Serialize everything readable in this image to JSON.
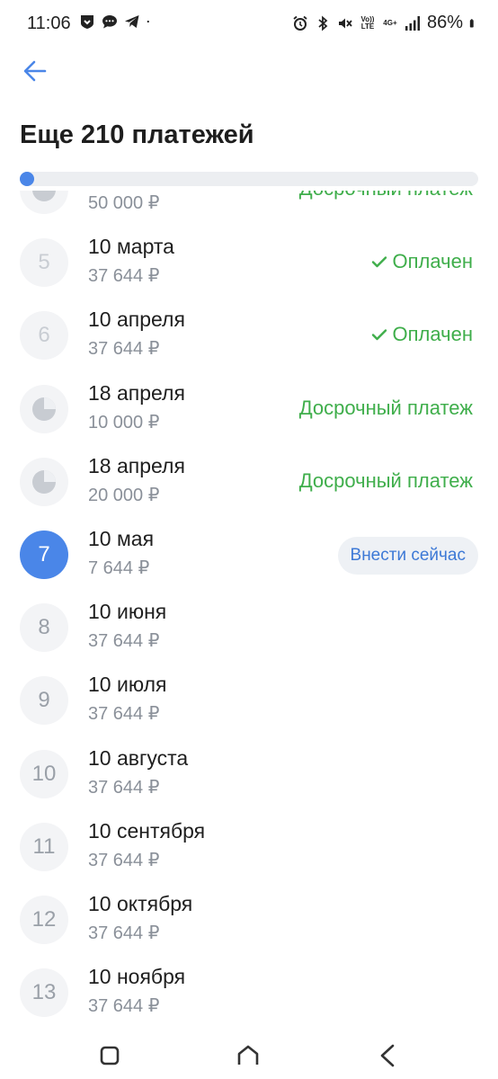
{
  "status_bar": {
    "time": "11:06",
    "battery": "86%",
    "volte": "Vo)) LTE",
    "network": "4G+"
  },
  "header": {
    "title": "Еще 210 платежей",
    "progress_fraction": 0.015
  },
  "colors": {
    "accent": "#4a86e8",
    "paid_green": "#3fae4b",
    "muted": "#8a9099"
  },
  "payments": [
    {
      "number": "",
      "date": "",
      "amount": "50 000 ₽",
      "status": "Досрочный платеж",
      "kind": "early"
    },
    {
      "number": "5",
      "date": "10 марта",
      "amount": "37 644 ₽",
      "status": "Оплачен",
      "kind": "paid"
    },
    {
      "number": "6",
      "date": "10 апреля",
      "amount": "37 644 ₽",
      "status": "Оплачен",
      "kind": "paid"
    },
    {
      "number": "",
      "date": "18 апреля",
      "amount": "10 000 ₽",
      "status": "Досрочный платеж",
      "kind": "early"
    },
    {
      "number": "",
      "date": "18 апреля",
      "amount": "20 000 ₽",
      "status": "Досрочный платеж",
      "kind": "early"
    },
    {
      "number": "7",
      "date": "10 мая",
      "amount": "7 644 ₽",
      "status": "Внести сейчас",
      "kind": "current"
    },
    {
      "number": "8",
      "date": "10 июня",
      "amount": "37 644 ₽",
      "status": "",
      "kind": "future"
    },
    {
      "number": "9",
      "date": "10 июля",
      "amount": "37 644 ₽",
      "status": "",
      "kind": "future"
    },
    {
      "number": "10",
      "date": "10 августа",
      "amount": "37 644 ₽",
      "status": "",
      "kind": "future"
    },
    {
      "number": "11",
      "date": "10 сентября",
      "amount": "37 644 ₽",
      "status": "",
      "kind": "future"
    },
    {
      "number": "12",
      "date": "10 октября",
      "amount": "37 644 ₽",
      "status": "",
      "kind": "future"
    },
    {
      "number": "13",
      "date": "10 ноября",
      "amount": "37 644 ₽",
      "status": "",
      "kind": "future"
    }
  ],
  "nav": {
    "recents_icon": "recents-icon",
    "home_icon": "home-icon",
    "back_icon": "back-icon"
  }
}
